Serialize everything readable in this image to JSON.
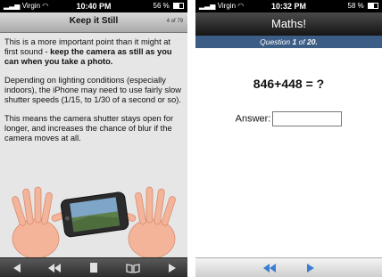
{
  "left_phone": {
    "status": {
      "carrier": "Virgin",
      "time": "10:40 PM",
      "battery": "56 %"
    },
    "title": "Keep it Still",
    "page_count": "4 of 79",
    "para1_plain": "This is a more important point than it might at first sound - ",
    "para1_bold": "keep the camera as still as you can when you take a photo.",
    "para2": "Depending on lighting conditions (especially indoors), the iPhone may need to use fairly slow shutter speeds (1/15, to 1/30 of a second or so).",
    "para3": "This means the camera shutter stays open for longer, and increases the chance of blur if the camera moves at all.",
    "toolbar_icons": [
      "back-arrow-icon",
      "rewind-icon",
      "page-icon",
      "book-icon",
      "forward-arrow-icon"
    ]
  },
  "right_phone": {
    "status": {
      "carrier": "Virgin",
      "time": "10:32 PM",
      "battery": "58 %"
    },
    "title": "Maths!",
    "question_prefix": "Question ",
    "question_current": "1",
    "question_mid": " of ",
    "question_total": "20.",
    "problem": "846+448 = ?",
    "answer_label": "Answer:",
    "answer_value": "",
    "toolbar_icons": [
      "rewind-icon",
      "play-icon"
    ],
    "accent": "#3c5d86"
  }
}
